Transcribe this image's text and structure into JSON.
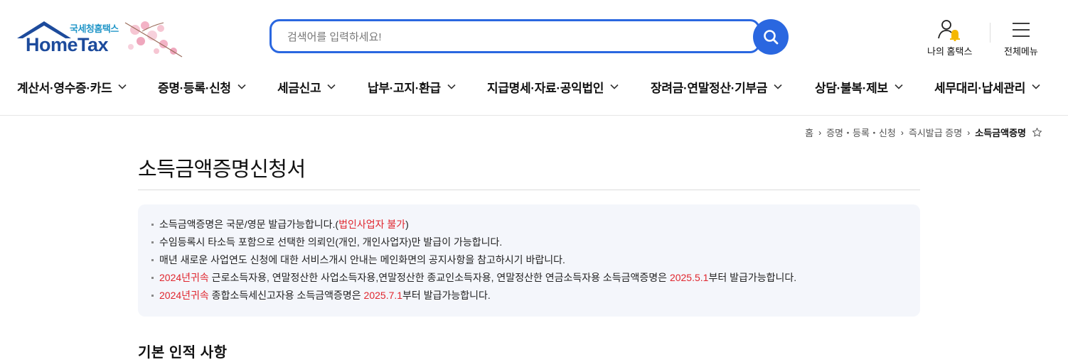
{
  "logo": {
    "sub": "국세청홈택스",
    "main": "HomeTax"
  },
  "search": {
    "placeholder": "검색어를 입력하세요!",
    "button_icon": "search-icon"
  },
  "utils": [
    {
      "label": "나의 홈택스",
      "icon": "user-bell-icon"
    },
    {
      "label": "전체메뉴",
      "icon": "hamburger-icon"
    }
  ],
  "nav": [
    {
      "label": "계산서·영수증·카드"
    },
    {
      "label": "증명·등록·신청"
    },
    {
      "label": "세금신고"
    },
    {
      "label": "납부·고지·환급"
    },
    {
      "label": "지급명세·자료·공익법인"
    },
    {
      "label": "장려금·연말정산·기부금"
    },
    {
      "label": "상담·불복·제보"
    },
    {
      "label": "세무대리·납세관리"
    }
  ],
  "breadcrumb": [
    "홈",
    "증명・등록・신청",
    "즉시발급 증명",
    "소득금액증명"
  ],
  "page_title": "소득금액증명신청서",
  "notices": [
    {
      "t1": "소득금액증명은 국문/영문 발급가능합니다.(",
      "r1": "법인사업자 불가",
      "t2": ")",
      "r2": "",
      "t3": ""
    },
    {
      "t1": "수임등록시 타소득 포함으로 선택한 의뢰인(개인, 개인사업자)만 발급이 가능합니다.",
      "r1": "",
      "t2": "",
      "r2": "",
      "t3": ""
    },
    {
      "t1": "매년 새로운 사업연도 신청에 대한 서비스개시 안내는 메인화면의 공지사항을 참고하시기 바랍니다.",
      "r1": "",
      "t2": "",
      "r2": "",
      "t3": ""
    },
    {
      "t1": "",
      "r1": "2024년귀속",
      "t2": " 근로소득자용, 연말정산한 사업소득자용,연말정산한 종교인소득자용, 연말정산한 연금소득자용 소득금액증명은 ",
      "r2": "2025.5.1",
      "t3": "부터 발급가능합니다."
    },
    {
      "t1": "",
      "r1": "2024년귀속",
      "t2": " 종합소득세신고자용 소득금액증명은 ",
      "r2": "2025.7.1",
      "t3": "부터 발급가능합니다."
    }
  ],
  "section_title": "기본 인적 사항",
  "colors": {
    "accent": "#2a67e0",
    "logo_blue": "#1d4b9c",
    "highlight_red": "#e0262e"
  }
}
